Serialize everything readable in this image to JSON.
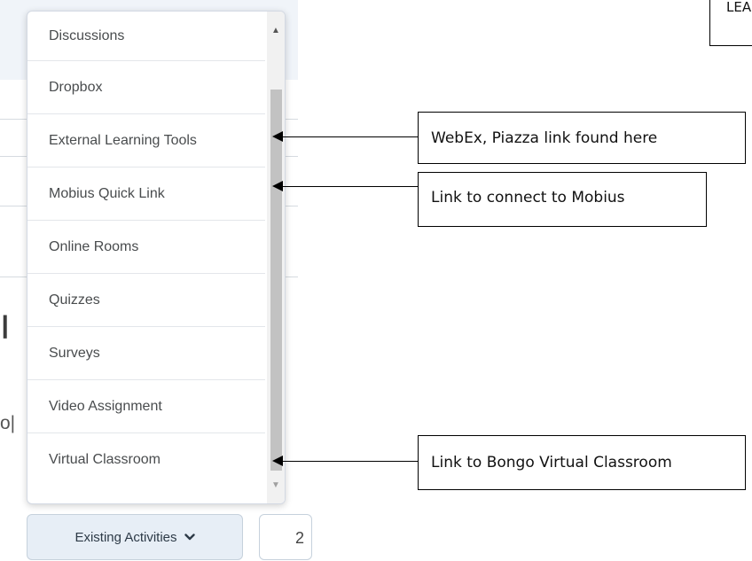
{
  "background": {
    "partial_heading": "ו",
    "partial_text": "o|"
  },
  "dropdown": {
    "items": [
      {
        "label": "Discussions"
      },
      {
        "label": "Dropbox"
      },
      {
        "label": "External Learning Tools"
      },
      {
        "label": "Mobius Quick Link"
      },
      {
        "label": "Online Rooms"
      },
      {
        "label": "Quizzes"
      },
      {
        "label": "Surveys"
      },
      {
        "label": "Video Assignment"
      },
      {
        "label": "Virtual Classroom"
      }
    ]
  },
  "buttons": {
    "existing_activities": "Existing Activities",
    "side_button_partial": "2"
  },
  "annotations": {
    "top_right_partial": "LEA",
    "webex": "WebEx, Piazza link found here",
    "mobius": "Link to connect to Mobius",
    "bongo": "Link to Bongo Virtual Classroom"
  },
  "icons": {
    "chevron": "chevron-down-icon",
    "scroll_up": "scroll-up-arrow-icon",
    "scroll_down": "scroll-down-arrow-icon"
  },
  "colors": {
    "accent_bg": "#e7eef6",
    "text": "#494c4e",
    "border": "#d3d9e3"
  }
}
